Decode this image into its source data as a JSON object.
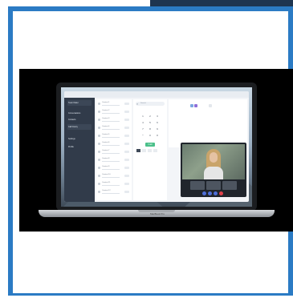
{
  "app": {
    "brand": "Team Dialer",
    "sidebar_items": [
      "Conversations",
      "Contacts",
      "Call history",
      "Settings"
    ],
    "sidebar_bottom": [
      "Profile"
    ]
  },
  "contacts": [
    "Contact 1",
    "Contact 2",
    "Contact 3",
    "Contact 4",
    "Contact 5",
    "Contact 6",
    "Contact 7",
    "Contact 8",
    "Contact 9",
    "Contact 10",
    "Contact 11",
    "Contact 12"
  ],
  "dialer": {
    "search_placeholder": "Search",
    "keys": [
      "1",
      "2",
      "3",
      "4",
      "5",
      "6",
      "7",
      "8",
      "9",
      "*",
      "0",
      "#"
    ],
    "call_label": "Call"
  },
  "video_call": {
    "participant_name": "",
    "thumbnails": 3
  },
  "laptop": {
    "model_label": "MacBook Pro"
  },
  "colors": {
    "frame": "#2b7bc4",
    "header_tab": "#1e3550",
    "sidebar": "#313b4a",
    "call_green": "#4bc08a",
    "end_red": "#e0414a"
  }
}
